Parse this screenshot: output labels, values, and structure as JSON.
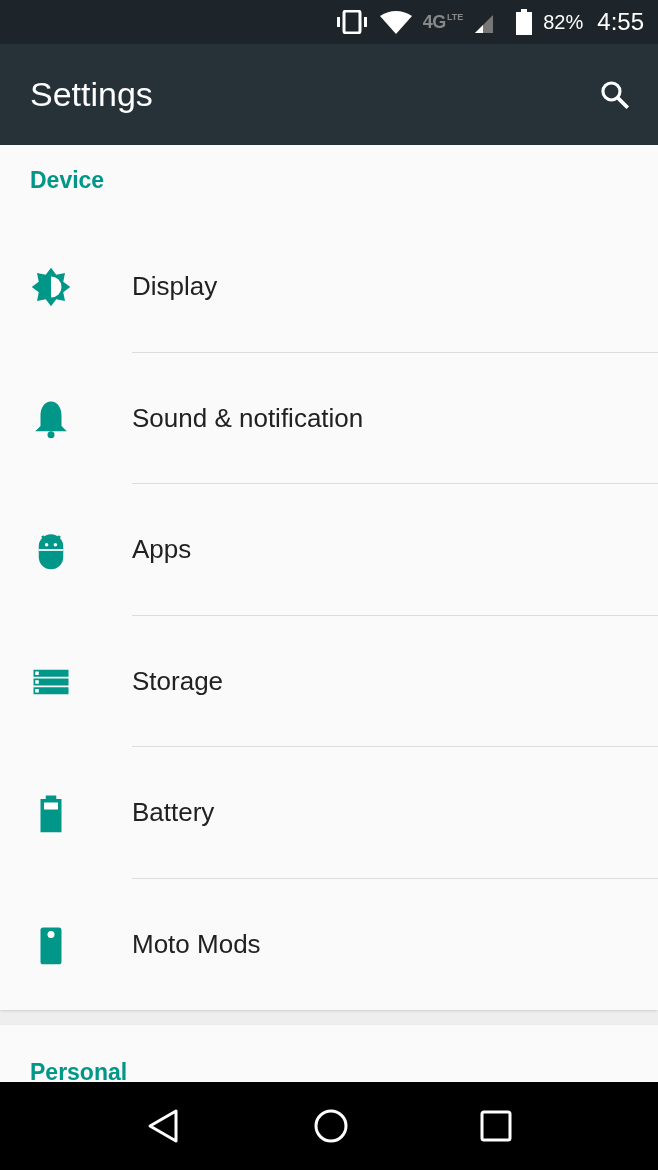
{
  "status_bar": {
    "network": "4G",
    "network_sub": "LTE",
    "battery": "82%",
    "time": "4:55"
  },
  "app_bar": {
    "title": "Settings"
  },
  "sections": [
    {
      "header": "Device",
      "items": [
        {
          "label": "Display"
        },
        {
          "label": "Sound & notification"
        },
        {
          "label": "Apps"
        },
        {
          "label": "Storage"
        },
        {
          "label": "Battery"
        },
        {
          "label": "Moto Mods"
        }
      ]
    },
    {
      "header": "Personal"
    }
  ]
}
